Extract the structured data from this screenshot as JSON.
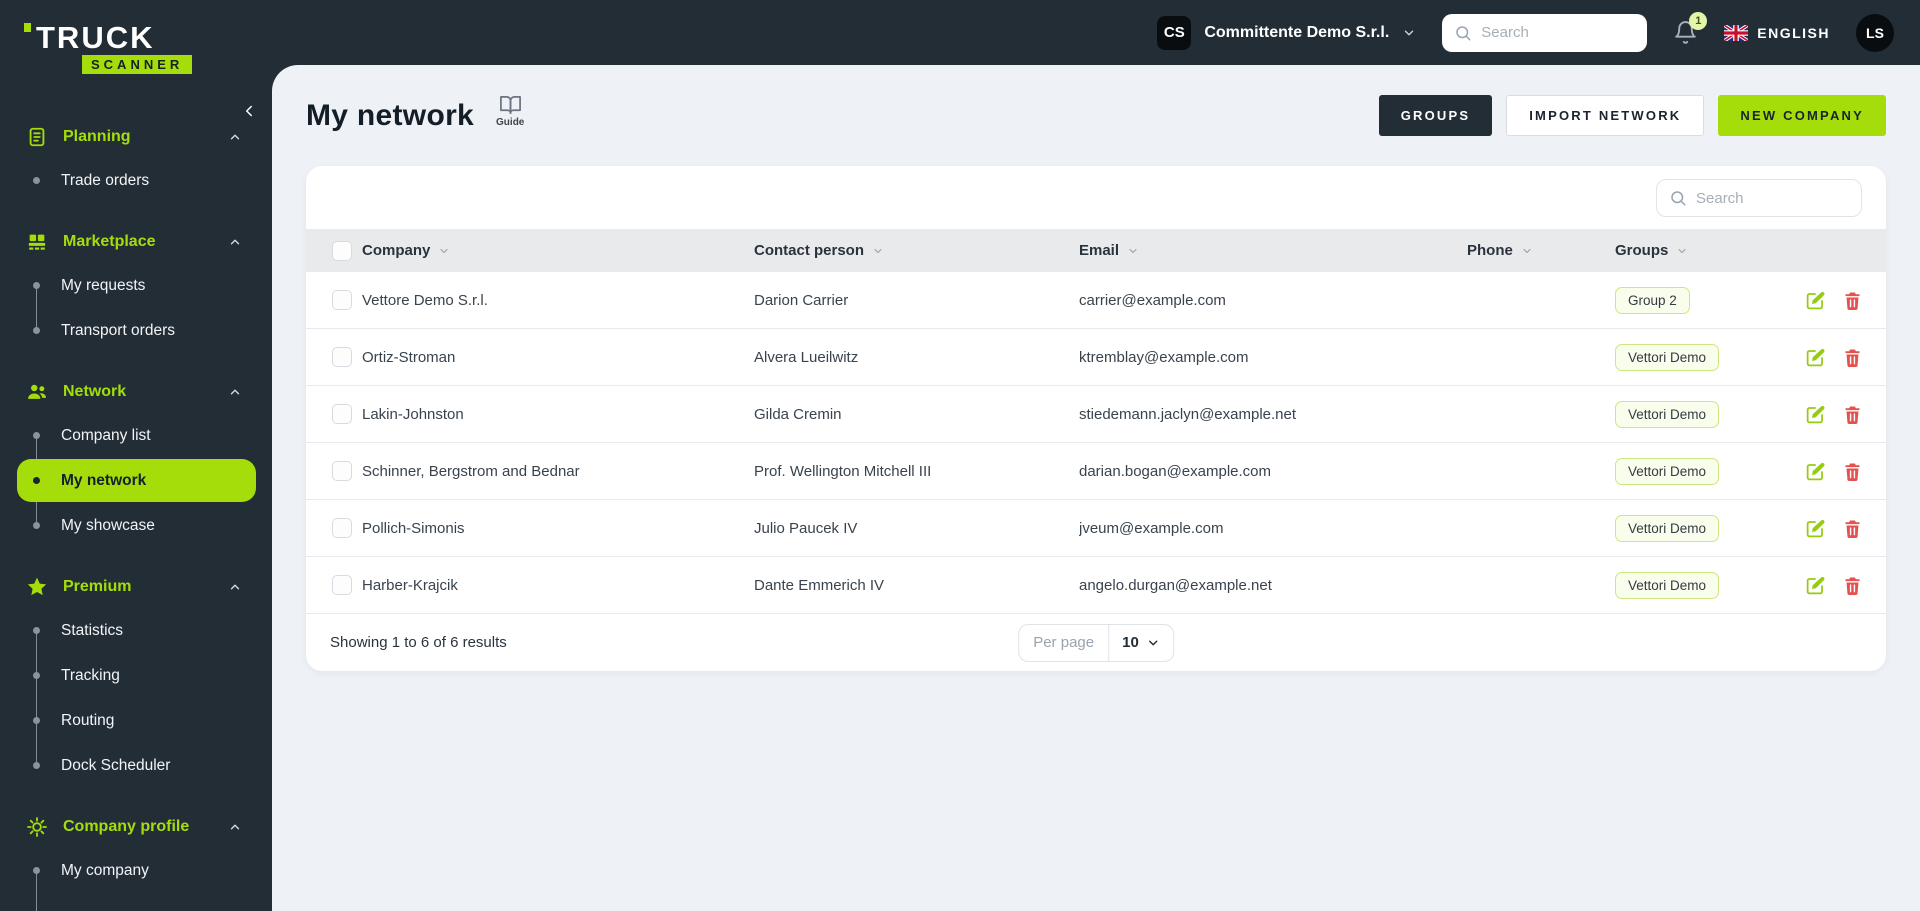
{
  "colors": {
    "accent": "#a5dd0b",
    "dark": "#222d36",
    "danger": "#e4514e"
  },
  "brand": {
    "title": "TRUCK",
    "subtitle": "SCANNER"
  },
  "topbar": {
    "company_initials": "CS",
    "company_name": "Committente Demo S.r.l.",
    "search_placeholder": "Search",
    "notifications_count": "1",
    "language": "ENGLISH",
    "user_initials": "LS"
  },
  "sidebar": {
    "sections": [
      {
        "label": "Planning",
        "icon": "clipboard-icon",
        "items": [
          {
            "label": "Trade orders"
          }
        ]
      },
      {
        "label": "Marketplace",
        "icon": "pallet-icon",
        "items": [
          {
            "label": "My requests"
          },
          {
            "label": "Transport orders"
          }
        ]
      },
      {
        "label": "Network",
        "icon": "people-icon",
        "items": [
          {
            "label": "Company list"
          },
          {
            "label": "My network",
            "active": true
          },
          {
            "label": "My showcase"
          }
        ]
      },
      {
        "label": "Premium",
        "icon": "star-icon",
        "items": [
          {
            "label": "Statistics"
          },
          {
            "label": "Tracking"
          },
          {
            "label": "Routing"
          },
          {
            "label": "Dock Scheduler"
          }
        ]
      },
      {
        "label": "Company profile",
        "icon": "gear-icon",
        "line_extends": true,
        "items": [
          {
            "label": "My company"
          }
        ]
      }
    ]
  },
  "page": {
    "title": "My network",
    "guide_label": "Guide",
    "actions": {
      "groups": "GROUPS",
      "import_network": "IMPORT NETWORK",
      "new_company": "NEW COMPANY"
    },
    "search_placeholder": "Search"
  },
  "table": {
    "columns": [
      "Company",
      "Contact person",
      "Email",
      "Phone",
      "Groups"
    ],
    "rows": [
      {
        "company": "Vettore Demo S.r.l.",
        "contact": "Darion Carrier",
        "email": "carrier@example.com",
        "phone": "",
        "group": "Group 2"
      },
      {
        "company": "Ortiz-Stroman",
        "contact": "Alvera Lueilwitz",
        "email": "ktremblay@example.com",
        "phone": "",
        "group": "Vettori Demo"
      },
      {
        "company": "Lakin-Johnston",
        "contact": "Gilda Cremin",
        "email": "stiedemann.jaclyn@example.net",
        "phone": "",
        "group": "Vettori Demo"
      },
      {
        "company": "Schinner, Bergstrom and Bednar",
        "contact": "Prof. Wellington Mitchell III",
        "email": "darian.bogan@example.com",
        "phone": "",
        "group": "Vettori Demo"
      },
      {
        "company": "Pollich-Simonis",
        "contact": "Julio Paucek IV",
        "email": "jveum@example.com",
        "phone": "",
        "group": "Vettori Demo"
      },
      {
        "company": "Harber-Krajcik",
        "contact": "Dante Emmerich IV",
        "email": "angelo.durgan@example.net",
        "phone": "",
        "group": "Vettori Demo"
      }
    ],
    "footer": {
      "summary": "Showing 1 to 6 of 6 results",
      "per_page_label": "Per page",
      "per_page_value": "10"
    }
  }
}
